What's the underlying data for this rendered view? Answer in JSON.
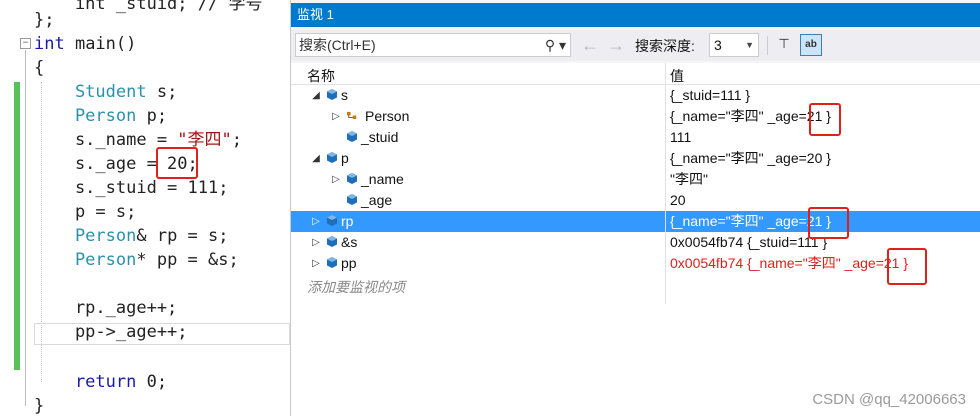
{
  "editor": {
    "lines": [
      {
        "parts": [
          [
            "",
            "    int _stuid; // 学号"
          ]
        ]
      },
      {
        "parts": [
          [
            "",
            "};"
          ]
        ]
      },
      {
        "parts": [
          [
            "kw",
            "int "
          ],
          [
            "",
            "main()"
          ]
        ]
      },
      {
        "parts": [
          [
            "",
            "{"
          ]
        ]
      },
      {
        "parts": [
          [
            "ty",
            "    Student"
          ],
          [
            "",
            " s;"
          ]
        ]
      },
      {
        "parts": [
          [
            "ty",
            "    Person"
          ],
          [
            "",
            " p;"
          ]
        ]
      },
      {
        "parts": [
          [
            "",
            "    s._name = "
          ],
          [
            "st",
            "\"李四\""
          ],
          [
            "",
            ";"
          ]
        ]
      },
      {
        "parts": [
          [
            "",
            "    s._age = 20;"
          ]
        ]
      },
      {
        "parts": [
          [
            "",
            "    s._stuid = 111;"
          ]
        ]
      },
      {
        "parts": [
          [
            "",
            "    p = s;"
          ]
        ]
      },
      {
        "parts": [
          [
            "ty",
            "    Person"
          ],
          [
            "",
            "& rp = s;"
          ]
        ]
      },
      {
        "parts": [
          [
            "ty",
            "    Person"
          ],
          [
            "",
            "* pp = &s;"
          ]
        ]
      },
      {
        "parts": [
          [
            "",
            ""
          ]
        ]
      },
      {
        "parts": [
          [
            "",
            "    rp._age++;"
          ]
        ]
      },
      {
        "parts": [
          [
            "",
            "    pp->_age++;"
          ]
        ]
      },
      {
        "parts": [
          [
            "",
            ""
          ]
        ]
      },
      {
        "parts": [
          [
            "kw",
            "    return "
          ],
          [
            "",
            "0;"
          ]
        ]
      },
      {
        "parts": [
          [
            "",
            "}"
          ]
        ]
      }
    ]
  },
  "watch": {
    "title": "监视 1",
    "search_placeholder": "搜索(Ctrl+E)",
    "search_icon": "search-icon",
    "depth_label": "搜索深度:",
    "depth_value": "3",
    "columns": {
      "name": "名称",
      "value": "值"
    },
    "rows": [
      {
        "name": "s",
        "value": "{_stuid=111 }",
        "expander": "expanded",
        "indent": 0,
        "icon": "class-object-icon",
        "selected": false,
        "changed": false
      },
      {
        "name": "Person",
        "value": "{_name=\"李四\" _age=21 }",
        "expander": "collapsed",
        "indent": 1,
        "icon": "base-class-icon",
        "selected": false,
        "changed": false
      },
      {
        "name": "_stuid",
        "value": "111",
        "expander": "none",
        "indent": 1,
        "icon": "field-icon",
        "selected": false,
        "changed": false
      },
      {
        "name": "p",
        "value": "{_name=\"李四\" _age=20 }",
        "expander": "expanded",
        "indent": 0,
        "icon": "class-object-icon",
        "selected": false,
        "changed": false
      },
      {
        "name": "_name",
        "value": "\"李四\"",
        "expander": "collapsed",
        "indent": 1,
        "icon": "field-icon",
        "selected": false,
        "changed": false
      },
      {
        "name": "_age",
        "value": "20",
        "expander": "none",
        "indent": 1,
        "icon": "field-icon",
        "selected": false,
        "changed": false
      },
      {
        "name": "rp",
        "value": "{_name=\"李四\" _age=21 }",
        "expander": "collapsed",
        "indent": 0,
        "icon": "class-object-icon",
        "selected": true,
        "changed": false
      },
      {
        "name": "&s",
        "value": "0x0054fb74 {_stuid=111 }",
        "expander": "collapsed",
        "indent": 0,
        "icon": "class-object-icon",
        "selected": false,
        "changed": false
      },
      {
        "name": "pp",
        "value": "0x0054fb74 {_name=\"李四\" _age=21 }",
        "expander": "collapsed",
        "indent": 0,
        "icon": "class-object-icon",
        "selected": false,
        "changed": true
      }
    ],
    "add_watch_placeholder": "添加要监视的项"
  },
  "watermark": "CSDN @qq_42006663",
  "colors": {
    "title_bar": "#007acc",
    "selection": "#3399ff",
    "changed_value": "#e0201b",
    "highlight_box": "#e0201b",
    "keyword": "#1a1aa6",
    "type": "#2b91af",
    "string": "#a31515",
    "modified_margin": "#57c15a"
  }
}
